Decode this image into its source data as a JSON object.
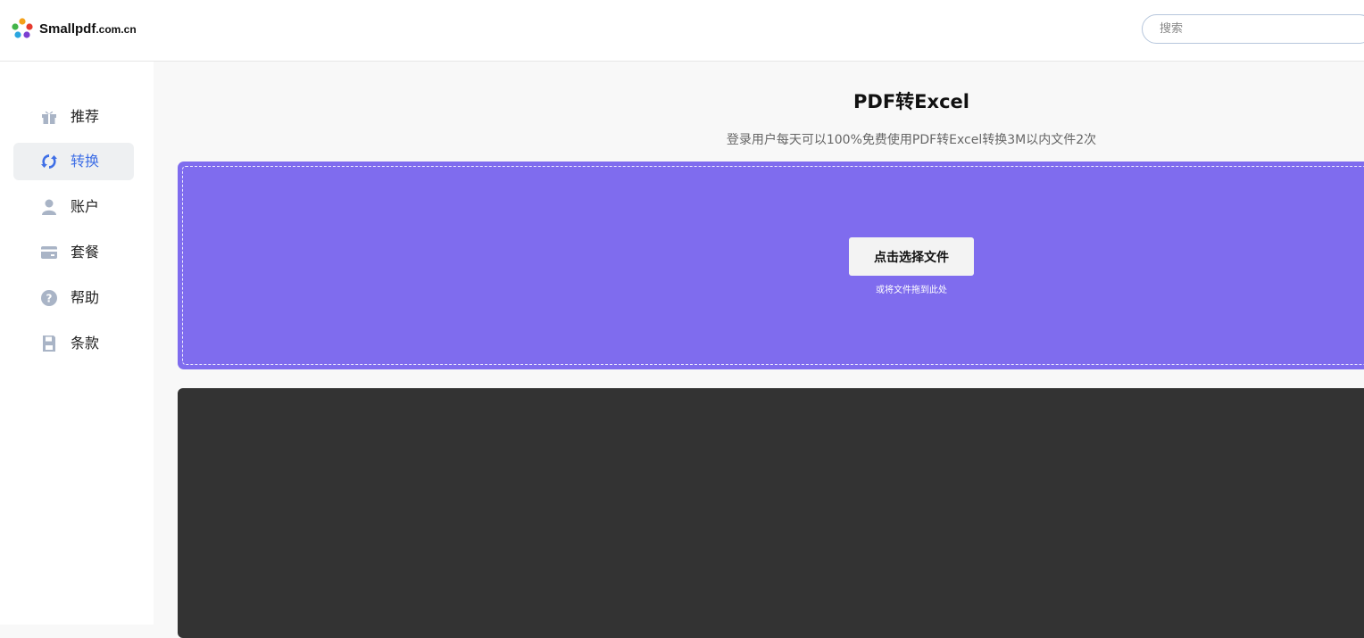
{
  "header": {
    "logo_text": "Smallpdf",
    "logo_domain": ".com.cn",
    "search_placeholder": "搜索"
  },
  "sidebar": {
    "items": [
      {
        "label": "推荐",
        "icon": "gift-icon",
        "active": false
      },
      {
        "label": "转换",
        "icon": "refresh-icon",
        "active": true
      },
      {
        "label": "账户",
        "icon": "user-icon",
        "active": false
      },
      {
        "label": "套餐",
        "icon": "card-icon",
        "active": false
      },
      {
        "label": "帮助",
        "icon": "help-circle-icon",
        "active": false
      },
      {
        "label": "条款",
        "icon": "save-icon",
        "active": false
      }
    ]
  },
  "main": {
    "title": "PDF转Excel",
    "subtitle": "登录用户每天可以100%免费使用PDF转Excel转换3M以内文件2次",
    "dropzone": {
      "button_label": "点击选择文件",
      "hint": "或将文件拖到此处"
    }
  },
  "colors": {
    "accent": "#3f6fe6",
    "dropzone": "#7f6cee",
    "dark_panel": "#333333",
    "icon_gray": "#a9b4c6"
  }
}
